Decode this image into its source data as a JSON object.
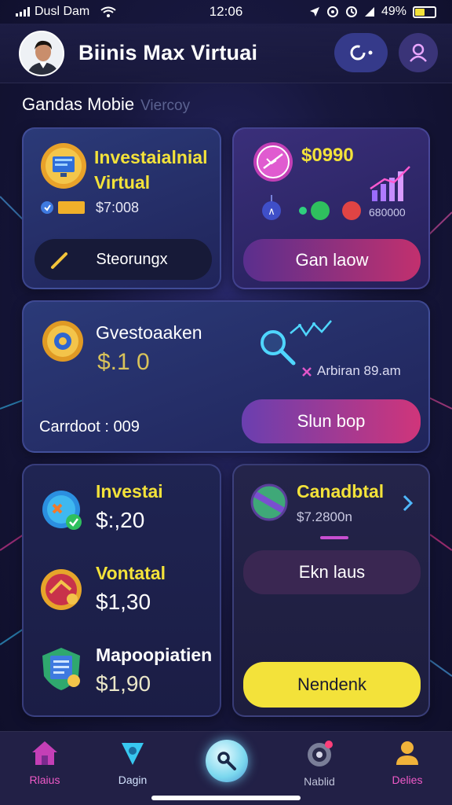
{
  "status_bar": {
    "carrier": "Dusl Dam",
    "time": "12:06",
    "battery": "49%",
    "battery_level": 0.49
  },
  "header": {
    "title": "Biinis Max Virtuai",
    "icons": [
      "refresh-icon",
      "user-icon"
    ]
  },
  "subtitle": {
    "main": "Gandas Mobie",
    "faded": "Viercoy"
  },
  "card1": {
    "title_line1": "Investaialnial",
    "title_line2": "Virtual",
    "amount": "$7:008",
    "button_label": "Steorungx"
  },
  "card2": {
    "amount": "$0990",
    "stat": "680000",
    "button_label": "Gan laow"
  },
  "card3": {
    "title": "Gvestoaaken",
    "amount": "$.1 0",
    "side_text": "Arbiran 89.am",
    "footer": "Carrdoot : 009",
    "button_label": "Slun bop"
  },
  "card4": {
    "items": [
      {
        "title": "Investai",
        "amount": "$:,20"
      },
      {
        "title": "Vontatal",
        "amount": "$1,30"
      },
      {
        "title": "Mapoopiatien",
        "amount": "$1,90"
      }
    ]
  },
  "card5": {
    "title": "Canadbtal",
    "amount": "$7.2800n",
    "button1_label": "Ekn laus",
    "button2_label": "Nendenk"
  },
  "bottom_nav": {
    "items": [
      {
        "label": "Rlaius",
        "icon": "home-icon"
      },
      {
        "label": "Dagin",
        "icon": "drop-icon"
      },
      {
        "label": "",
        "icon": "wrench-icon"
      },
      {
        "label": "Nablid",
        "icon": "target-icon"
      },
      {
        "label": "Delies",
        "icon": "person-icon"
      }
    ]
  },
  "colors": {
    "accent_yellow": "#f3e23a",
    "accent_pink": "#d8327a",
    "accent_purple": "#6a3fb0",
    "bg_dark": "#17173d"
  }
}
